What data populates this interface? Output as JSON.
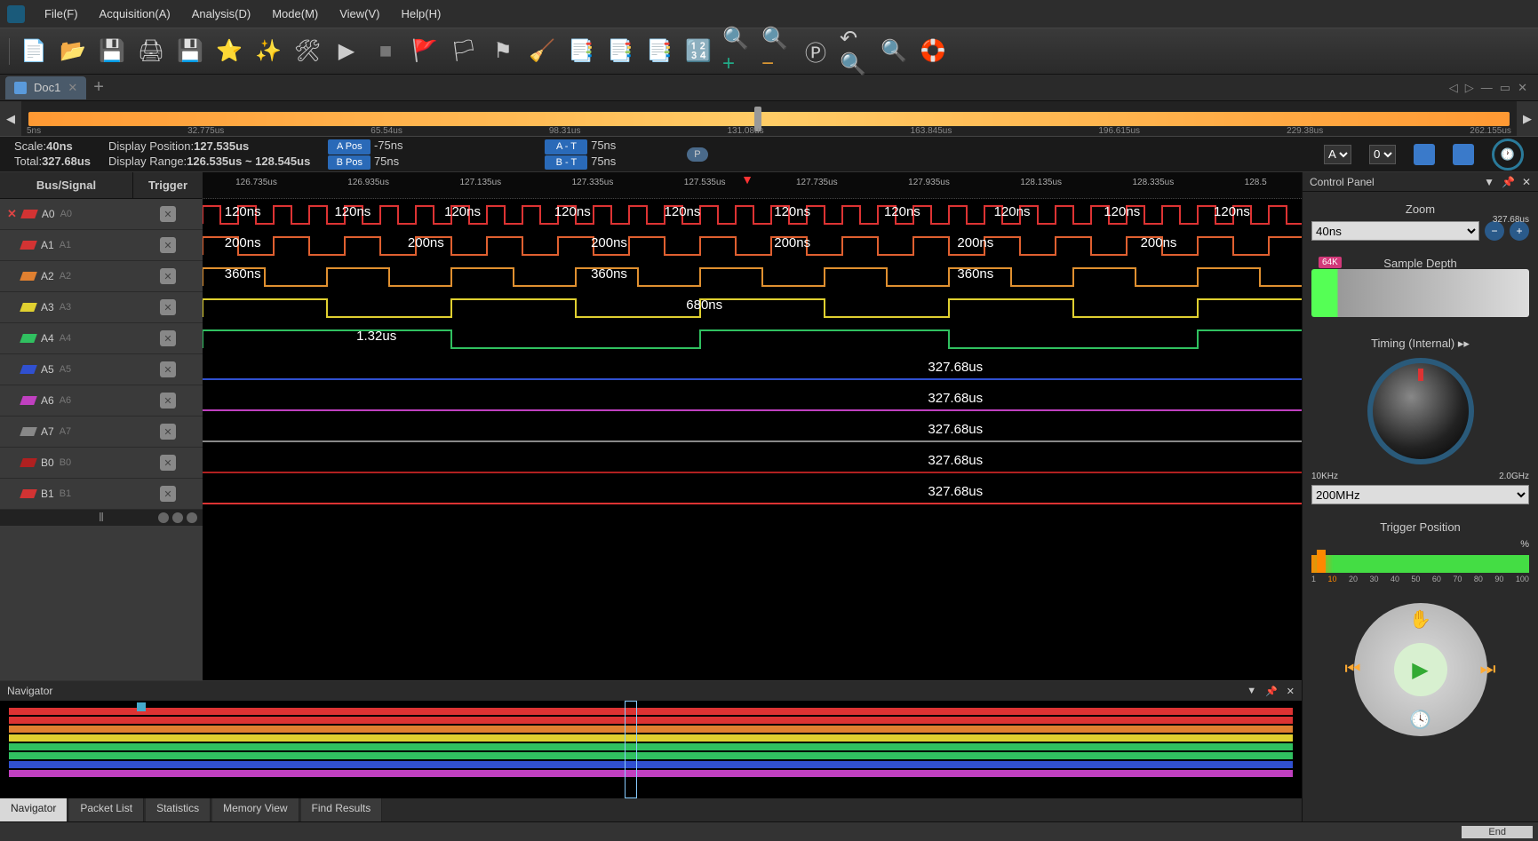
{
  "menu": [
    "File(F)",
    "Acquisition(A)",
    "Analysis(D)",
    "Mode(M)",
    "View(V)",
    "Help(H)"
  ],
  "toolbar": [
    {
      "name": "new-file-icon",
      "glyph": "📄"
    },
    {
      "name": "open-folder-icon",
      "glyph": "📂"
    },
    {
      "name": "save-icon",
      "glyph": "💾"
    },
    {
      "name": "print-icon",
      "glyph": "🖨"
    },
    {
      "name": "save-settings-icon",
      "glyph": "💾"
    },
    {
      "name": "favorite-icon",
      "glyph": "⭐"
    },
    {
      "name": "wizard-icon",
      "glyph": "✨"
    },
    {
      "name": "tools-icon",
      "glyph": "🛠"
    },
    {
      "name": "run-icon",
      "glyph": "▶"
    },
    {
      "name": "stop-icon",
      "glyph": "■",
      "color": "#777"
    },
    {
      "name": "flag-add-icon",
      "glyph": "🚩"
    },
    {
      "name": "flag-left-icon",
      "glyph": "🏳"
    },
    {
      "name": "flag-down-icon",
      "glyph": "⚑"
    },
    {
      "name": "eraser-icon",
      "glyph": "🧹"
    },
    {
      "name": "page-copy-icon",
      "glyph": "📑"
    },
    {
      "name": "pages-icon",
      "glyph": "📑"
    },
    {
      "name": "documents-icon",
      "glyph": "📑"
    },
    {
      "name": "binary-icon",
      "glyph": "🔢"
    },
    {
      "name": "zoom-in-icon",
      "glyph": "🔍+",
      "color": "#2a8"
    },
    {
      "name": "zoom-out-icon",
      "glyph": "🔍−",
      "color": "#d93"
    },
    {
      "name": "zoom-page-icon",
      "glyph": "Ⓟ"
    },
    {
      "name": "zoom-undo-icon",
      "glyph": "↶🔍"
    },
    {
      "name": "search-icon",
      "glyph": "🔍"
    },
    {
      "name": "lifebuoy-icon",
      "glyph": "🛟"
    }
  ],
  "doctab": {
    "title": "Doc1"
  },
  "overview_ticks": [
    "5ns",
    "32.775us",
    "65.54us",
    "98.31us",
    "131.08us",
    "163.845us",
    "196.615us",
    "229.38us",
    "262.155us"
  ],
  "info": {
    "scale_label": "Scale:",
    "scale": "40ns",
    "total_label": "Total:",
    "total": "327.68us",
    "disp_pos_label": "Display Position:",
    "disp_pos": "127.535us",
    "disp_range_label": "Display Range:",
    "disp_range": "126.535us ~ 128.545us",
    "apos_tag": "A Pos",
    "apos_val": "-75ns",
    "bpos_tag": "B Pos",
    "bpos_val": "75ns",
    "at_tag": "A - T",
    "at_val": "75ns",
    "bt_tag": "B - T",
    "bt_val": "75ns",
    "p_label": "P",
    "sel1": "A",
    "sel2": "0"
  },
  "signals": {
    "col1": "Bus/Signal",
    "col2": "Trigger",
    "channels": [
      {
        "name": "A0",
        "sub": "A0",
        "color": "#d33333",
        "delete": true
      },
      {
        "name": "A1",
        "sub": "A1",
        "color": "#d33333"
      },
      {
        "name": "A2",
        "sub": "A2",
        "color": "#e08030"
      },
      {
        "name": "A3",
        "sub": "A3",
        "color": "#e0d030"
      },
      {
        "name": "A4",
        "sub": "A4",
        "color": "#30c060"
      },
      {
        "name": "A5",
        "sub": "A5",
        "color": "#3050d0"
      },
      {
        "name": "A6",
        "sub": "A6",
        "color": "#c040c0"
      },
      {
        "name": "A7",
        "sub": "A7",
        "color": "#888"
      },
      {
        "name": "B0",
        "sub": "B0",
        "color": "#b02020"
      },
      {
        "name": "B1",
        "sub": "B1",
        "color": "#d33333"
      }
    ]
  },
  "ruler_ticks": [
    "126.735us",
    "126.935us",
    "127.135us",
    "127.335us",
    "127.535us",
    "127.735us",
    "127.935us",
    "128.135us",
    "128.335us",
    "128.5"
  ],
  "waves": {
    "a0_label": "120ns",
    "a1_label": "200ns",
    "a2_label": "360ns",
    "a3_label": "680ns",
    "a4_label": "1.32us",
    "a5_label": "327.68us",
    "a6_label": "327.68us",
    "a7_label": "327.68us",
    "b0_label": "327.68us",
    "b1_label": "327.68us"
  },
  "navigator": {
    "title": "Navigator",
    "tabs": [
      "Navigator",
      "Packet List",
      "Statistics",
      "Memory View",
      "Find Results"
    ]
  },
  "control": {
    "title": "Control Panel",
    "zoom_title": "Zoom",
    "zoom_sel": "40ns",
    "depth_title": "Sample Depth",
    "depth_badge": "64K",
    "depth_end": "327.68us",
    "timing_title": "Timing (Internal)",
    "freq_lo": "10KHz",
    "freq_hi": "2.0GHz",
    "freq_sel": "200MHz",
    "trigpos_title": "Trigger Position",
    "trigpos_pct": "%",
    "trigscale": [
      "1",
      "10",
      "20",
      "30",
      "40",
      "50",
      "60",
      "70",
      "80",
      "90",
      "100"
    ]
  },
  "status": {
    "end": "End"
  }
}
